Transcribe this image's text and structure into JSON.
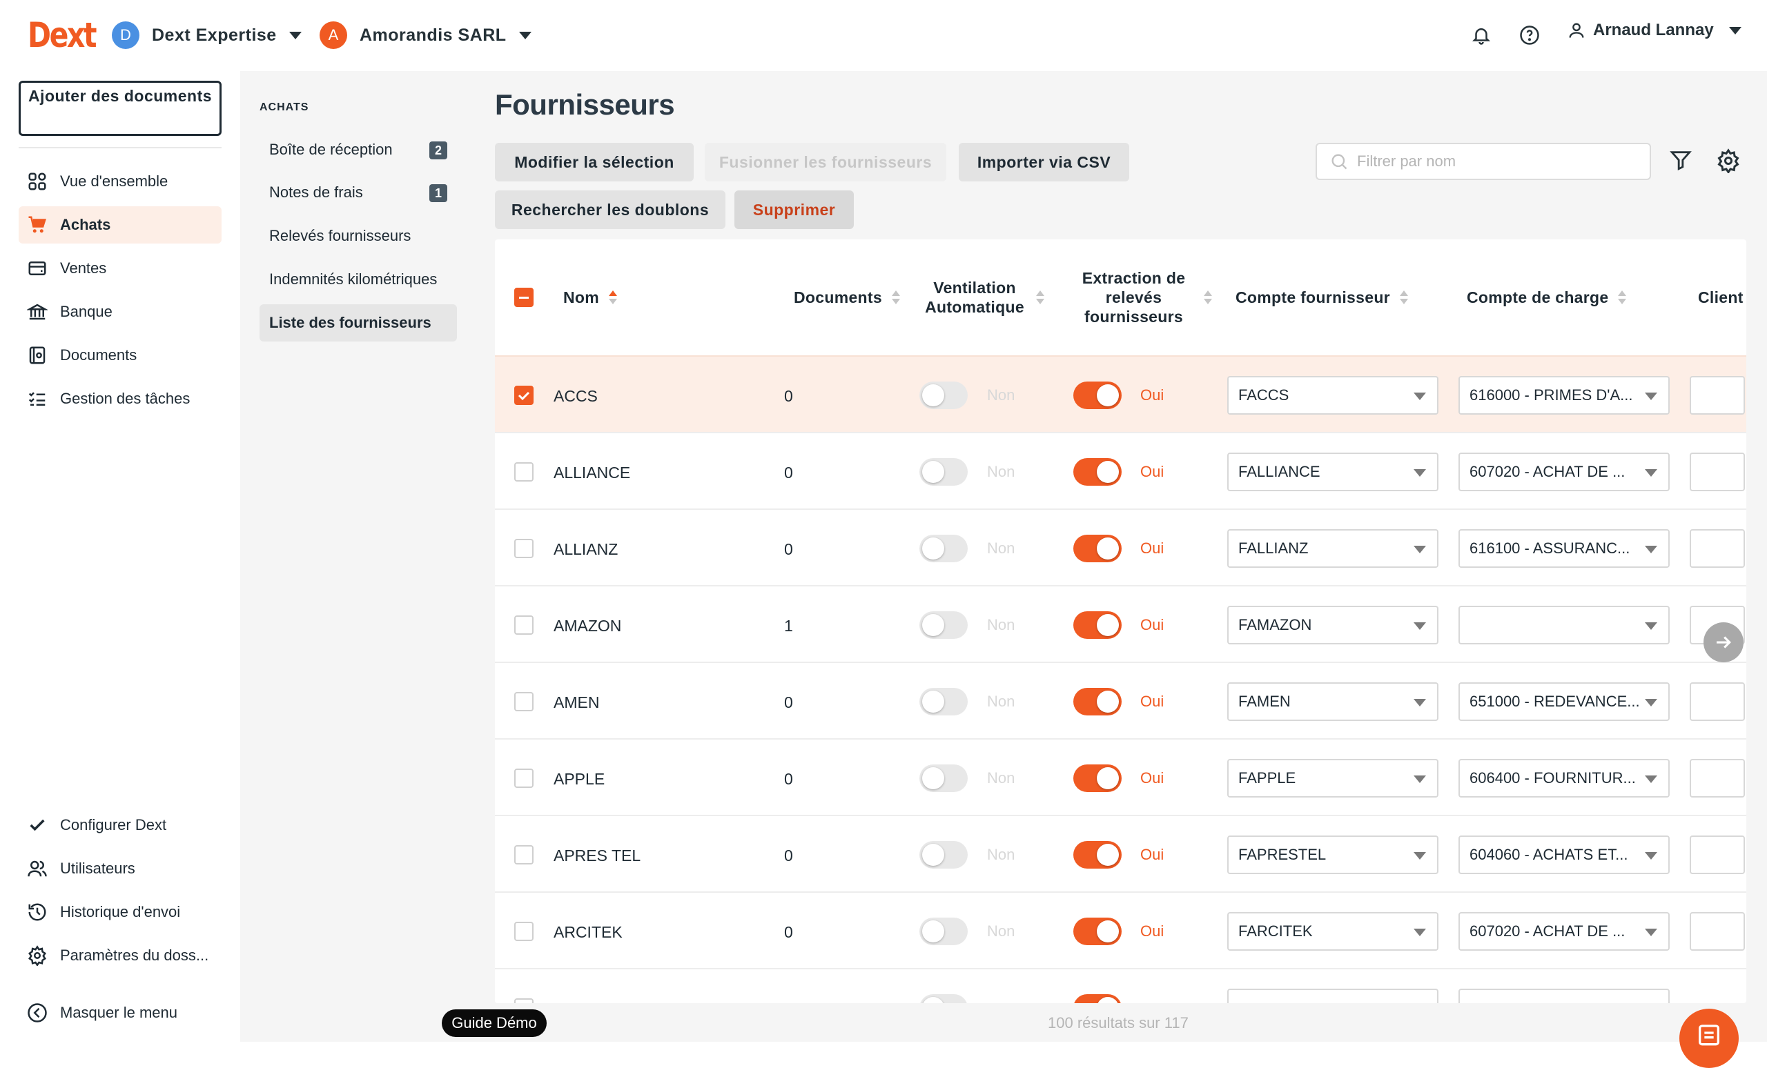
{
  "app": {
    "logo": "Dext"
  },
  "topbar": {
    "workspace": {
      "initial": "D",
      "name": "Dext Expertise",
      "color": "#4a90e2"
    },
    "client": {
      "initial": "A",
      "name": "Amorandis SARL",
      "color": "#f05a22"
    },
    "user": "Arnaud Lannay"
  },
  "sidebar": {
    "add_button": "Ajouter des documents",
    "items": [
      {
        "label": "Vue d'ensemble",
        "icon": "grid-icon"
      },
      {
        "label": "Achats",
        "icon": "cart-icon",
        "active": true
      },
      {
        "label": "Ventes",
        "icon": "wallet-icon"
      },
      {
        "label": "Banque",
        "icon": "bank-icon"
      },
      {
        "label": "Documents",
        "icon": "document-icon"
      },
      {
        "label": "Gestion des tâches",
        "icon": "tasks-icon"
      }
    ],
    "bottom_items": [
      {
        "label": "Configurer Dext",
        "icon": "check-icon"
      },
      {
        "label": "Utilisateurs",
        "icon": "users-icon"
      },
      {
        "label": "Historique d'envoi",
        "icon": "history-icon"
      },
      {
        "label": "Paramètres du doss...",
        "icon": "gear-icon"
      }
    ],
    "hide_menu": "Masquer le menu"
  },
  "subnav": {
    "header": "ACHATS",
    "items": [
      {
        "label": "Boîte de réception",
        "badge": "2"
      },
      {
        "label": "Notes de frais",
        "badge": "1"
      },
      {
        "label": "Relevés fournisseurs"
      },
      {
        "label": "Indemnités kilométriques"
      },
      {
        "label": "Liste des fournisseurs",
        "active": true
      }
    ]
  },
  "main": {
    "title": "Fournisseurs",
    "buttons": {
      "modify": "Modifier la sélection",
      "merge": "Fusionner les fournisseurs",
      "import": "Importer via CSV",
      "duplicates": "Rechercher les doublons",
      "delete": "Supprimer"
    },
    "search_placeholder": "Filtrer par nom",
    "columns": {
      "name": "Nom",
      "documents": "Documents",
      "ventilation": "Ventilation Automatique",
      "extraction": "Extraction de relevés fournisseurs",
      "supplier_account": "Compte fournisseur",
      "charge_account": "Compte de charge",
      "client": "Client"
    },
    "toggle_off_label": "Non",
    "toggle_on_label": "Oui",
    "rows": [
      {
        "name": "ACCS",
        "documents": "0",
        "selected": true,
        "supplier": "FACCS",
        "charge": "616000 - PRIMES D'A..."
      },
      {
        "name": "ALLIANCE",
        "documents": "0",
        "selected": false,
        "supplier": "FALLIANCE",
        "charge": "607020 - ACHAT DE ..."
      },
      {
        "name": "ALLIANZ",
        "documents": "0",
        "selected": false,
        "supplier": "FALLIANZ",
        "charge": "616100 - ASSURANC..."
      },
      {
        "name": "AMAZON",
        "documents": "1",
        "selected": false,
        "supplier": "FAMAZON",
        "charge": ""
      },
      {
        "name": "AMEN",
        "documents": "0",
        "selected": false,
        "supplier": "FAMEN",
        "charge": "651000 - REDEVANCE..."
      },
      {
        "name": "APPLE",
        "documents": "0",
        "selected": false,
        "supplier": "FAPPLE",
        "charge": "606400 - FOURNITUR..."
      },
      {
        "name": "APRES TEL",
        "documents": "0",
        "selected": false,
        "supplier": "FAPRESTEL",
        "charge": "604060 - ACHATS ET..."
      },
      {
        "name": "ARCITEK",
        "documents": "0",
        "selected": false,
        "supplier": "FARCITEK",
        "charge": "607020 - ACHAT DE ..."
      }
    ],
    "results": "100 résultats sur 117"
  },
  "guide": "Guide Démo",
  "colors": {
    "accent": "#f05a22",
    "selected_row": "#fdeee6"
  }
}
